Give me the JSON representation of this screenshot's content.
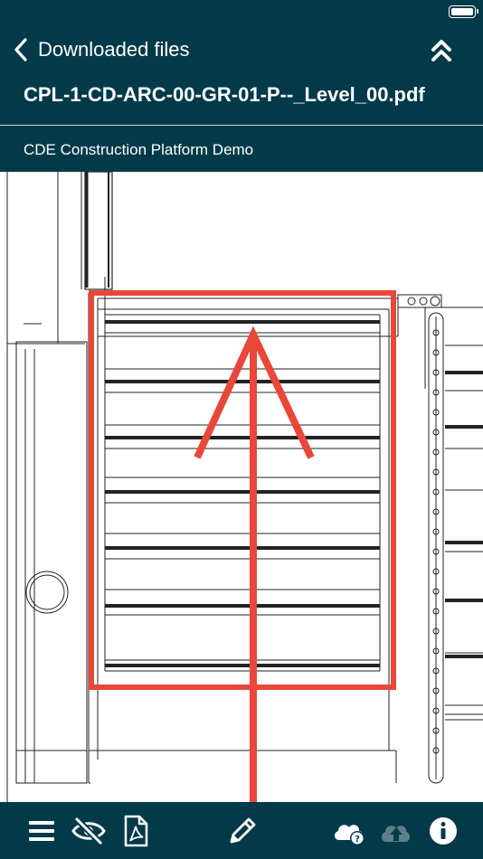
{
  "header": {
    "back_label": "Downloaded files",
    "file_title": "CPL-1-CD-ARC-00-GR-01-P--_Level_00.pdf",
    "project_name": "CDE Construction Platform Demo"
  },
  "icons": {
    "back": "chevron-left-icon",
    "collapse": "double-chevron-up-icon",
    "menu": "hamburger-menu-icon",
    "visibility": "eye-off-icon",
    "pdf": "pdf-file-icon",
    "annotate": "pencil-icon",
    "cloud_help": "cloud-question-icon",
    "cloud_upload": "cloud-upload-icon",
    "info": "info-icon"
  },
  "colors": {
    "header_bg": "#033a4a",
    "markup_red": "#e8473a",
    "upload_disabled": "#5c7f88"
  }
}
